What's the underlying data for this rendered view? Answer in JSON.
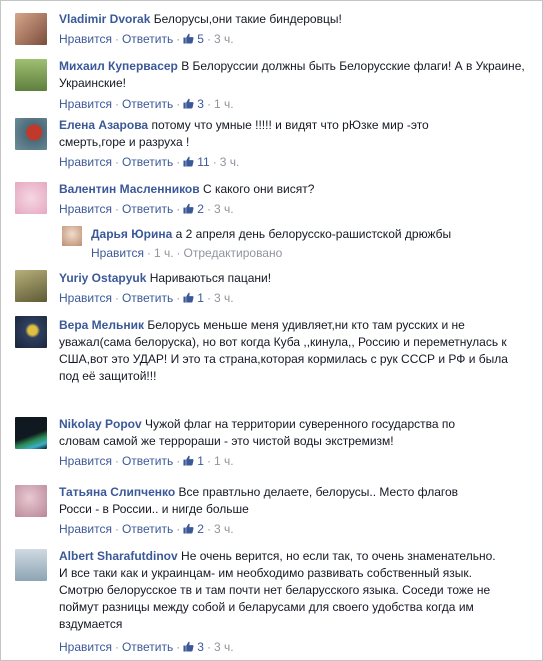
{
  "labels": {
    "like": "Нравится",
    "reply": "Ответить",
    "separator": "·",
    "edited": "Отредактировано"
  },
  "comments": [
    {
      "author": "Vladimir Dvorak",
      "text": "Белорусы,они такие биндеровцы!",
      "likes": "5",
      "time": "3 ч.",
      "avatar_color": "#b5846a"
    },
    {
      "author": "Михаил Куперવасер",
      "text": "",
      "likes": "3",
      "time": "1 ч.",
      "avatar_color": "#7f9f58"
    },
    {
      "author": "Елена Азарова",
      "text": "потому что умные !!!!! и видят что рЮзке мир -это смерть,горе и разруха !",
      "likes": "11",
      "time": "3 ч.",
      "avatar_color": "#4b6b78"
    },
    {
      "author": "Валентин Масленников",
      "text": "С какого они висят?",
      "likes": "2",
      "time": "3 ч.",
      "avatar_color": "#e6b8c8"
    },
    {
      "author": "Дарья Юрина",
      "text": "а 2 апреля день белорусско-рашистской дрюжбы",
      "time": "1 ч.",
      "avatar_color": "#d9c6b8"
    },
    {
      "author": "Yuriy Ostapyuk",
      "text": "Нариваються пацани!",
      "likes": "1",
      "time": "3 ч.",
      "avatar_color": "#8a8456"
    },
    {
      "author": "Вера Мельник",
      "text": "Белорусь меньше меня удивляет,ни кто там русских и не уважал(сама белоруска), но вот когда Куба ,,кинула,, Россию и переметнулась к США,вот это УДАР! И это та страна,которая кормилась с рук СССР и РФ и была под её защитой!!!",
      "time": "3 ч.",
      "avatar_color": "#2e3f5e"
    },
    {
      "author": "Nikolay Popov",
      "text": "Чужой флаг на территории суверенного государства по словам самой же террораши - это чистой воды экстремизм!",
      "likes": "1",
      "time": "1 ч.",
      "avatar_color": "#1c2430"
    },
    {
      "author": "Татьяна Слипченко",
      "text": "Все правтльно делаете, белорусы.. Место флагов Росси - в России.. и нигде больше",
      "likes": "2",
      "time": "3 ч.",
      "avatar_color": "#c89aa8"
    },
    {
      "author": "Albert Sharafutdinov",
      "text": "Не очень верится, но если так, то очень знаменательно. И все таки как и украинцам- им необходимо развивать собственный язык. Смотрю белорусское тв и там почти нет беларусского языка. Соседи тоже не поймут разницы между собой и беларусами для своего удобства когда им вздумается",
      "likes": "3",
      "time": "3 ч.",
      "avatar_color": "#b6c5cf"
    }
  ],
  "comment2_text": "В Белоруссии должны быть Белорусские флаги! А в Украине, Украинские!",
  "comment2_author": "Михаил Купервасер"
}
